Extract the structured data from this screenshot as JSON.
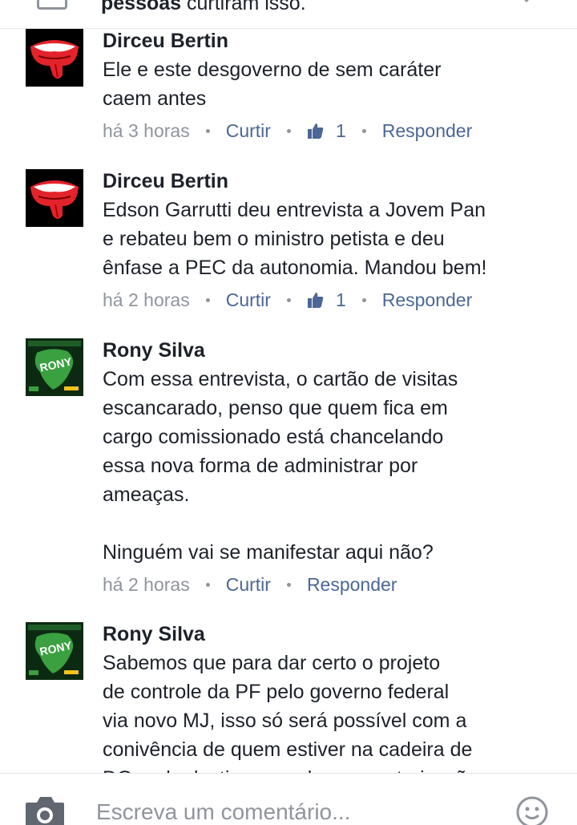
{
  "header": {
    "likes_bold": "pessoas",
    "likes_rest": " curtiram isso."
  },
  "comments": [
    {
      "author": "Dirceu Bertin",
      "avatar": "rolling-stones-tongue-logo",
      "text": "Ele e este desgoverno de sem caráter\ncaem antes",
      "time": "há 3 horas",
      "like_label": "Curtir",
      "like_count": "1",
      "reply_label": "Responder"
    },
    {
      "author": "Dirceu Bertin",
      "avatar": "rolling-stones-tongue-logo",
      "text": "Edson Garrutti deu entrevista a Jovem Pan\ne rebateu bem o ministro petista e deu\nênfase a PEC da autonomia. Mandou bem!",
      "time": "há 2 horas",
      "like_label": "Curtir",
      "like_count": "1",
      "reply_label": "Responder"
    },
    {
      "author": "Rony Silva",
      "avatar": "rony-campaign-brazil-map",
      "text": "Com essa entrevista, o cartão de visitas\nescancarado, penso que quem fica em\ncargo comissionado está chancelando\nessa nova forma de administrar por\nameaças.\n\nNinguém vai se manifestar aqui não?",
      "time": "há 2 horas",
      "like_label": "Curtir",
      "reply_label": "Responder"
    },
    {
      "author": "Rony Silva",
      "avatar": "rony-campaign-brazil-map",
      "text": "Sabemos que para dar certo o projeto\nde controle da PF pelo governo federal\nvia novo MJ, isso só será possível com a\nconivência de quem estiver na cadeira de\nDG, pelo destino que ele quer autorizações"
    }
  ],
  "composer": {
    "placeholder": "Escreva um comentário..."
  },
  "colors": {
    "link": "#4b6798",
    "meta": "#90949c",
    "text": "#1d2129",
    "stones_red": "#e3232b",
    "rony_green": "#3aa040"
  },
  "icons": [
    "thumbs-up-icon",
    "camera-icon",
    "smiley-icon",
    "chevron-down-icon"
  ]
}
